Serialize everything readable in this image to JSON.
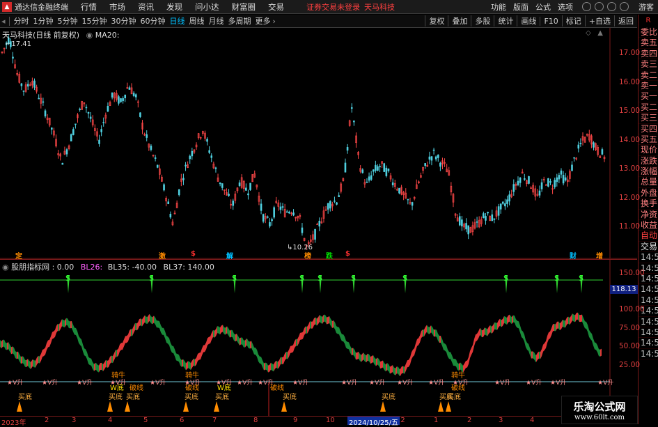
{
  "app": {
    "name": "通达信金融终端",
    "menus": [
      "行情",
      "市场",
      "资讯",
      "发现",
      "问小达",
      "财富圈",
      "交易"
    ],
    "notice": "证券交易未登录",
    "stock_name": "天马科技",
    "right_menus": [
      "功能",
      "版面",
      "公式",
      "选项"
    ],
    "guest": "游客"
  },
  "toolbar": {
    "periods": [
      "分时",
      "1分钟",
      "5分钟",
      "15分钟",
      "30分钟",
      "60分钟",
      "日线",
      "周线",
      "月线",
      "多周期",
      "更多"
    ],
    "active_period": "日线",
    "buttons": [
      "复权",
      "叠加",
      "多股",
      "统计",
      "画线",
      "F10",
      "标记",
      "+自选",
      "返回"
    ]
  },
  "right_panel": {
    "top": "R",
    "items": [
      "委比",
      "卖五",
      "卖四",
      "卖三",
      "卖二",
      "卖一",
      "买一",
      "买二",
      "买三",
      "买四",
      "买五",
      "现价",
      "涨跌",
      "涨幅",
      "总量",
      "外盘",
      "换手",
      "净资",
      "收益",
      "自动",
      "交易",
      "14:56",
      "14:56",
      "14:56",
      "14:56",
      "14:56",
      "14:56",
      "14:56",
      "14:56",
      "14:56",
      "14:56"
    ]
  },
  "main_chart": {
    "title": "天马科技(日线 前复权)",
    "indicator": "MA20:",
    "high_label": "17.41",
    "low_label": "10.26",
    "y_ticks": [
      "17.00",
      "16.00",
      "15.00",
      "14.00",
      "13.00",
      "12.00",
      "11.00"
    ],
    "events": [
      {
        "t": "定",
        "c": "#ff8c00"
      },
      {
        "t": "激",
        "c": "#ff8c00"
      },
      {
        "t": "$",
        "c": "#ff3030"
      },
      {
        "t": "解",
        "c": "#00c0ff"
      },
      {
        "t": "榜",
        "c": "#ff8c00"
      },
      {
        "t": "跌",
        "c": "#00e000"
      },
      {
        "t": "$",
        "c": "#ff3030"
      },
      {
        "t": "财",
        "c": "#00c0ff"
      },
      {
        "t": "增",
        "c": "#ff8c00"
      }
    ]
  },
  "sub_chart": {
    "title": "股朋指标网",
    "v0": ": 0.00",
    "bl26": "BL26:",
    "bl35": "BL35: -40.00",
    "bl37": "BL37: 140.00",
    "y_ticks": [
      "150.00",
      "100.00",
      "75.00",
      "50.00",
      "25.00"
    ],
    "current_value": "118.13",
    "signal_s": "S",
    "signal_up": "V升",
    "labels": [
      "骑牛",
      "W底",
      "破线",
      "买底",
      "骑牛",
      "破线"
    ]
  },
  "x_axis": {
    "labels": [
      "2023年",
      "2",
      "3",
      "4",
      "5",
      "6",
      "7",
      "8",
      "9",
      "10",
      "11",
      "12",
      "1",
      "2",
      "3",
      "4"
    ],
    "selected_date": "2024/10/25/五"
  },
  "watermark": {
    "title": "乐淘公式网",
    "url": "www.60lt.com"
  },
  "chart_data": {
    "type": "candlestick",
    "title": "天马科技(日线 前复权)",
    "ylim": [
      10.2,
      17.5
    ],
    "close_path": [
      16.9,
      17.41,
      16.2,
      15.6,
      16.0,
      15.4,
      14.8,
      14.1,
      13.2,
      13.8,
      14.6,
      15.3,
      14.6,
      13.9,
      14.9,
      15.5,
      15.2,
      15.8,
      15.4,
      14.3,
      13.6,
      13.0,
      12.1,
      11.1,
      12.5,
      13.2,
      13.8,
      14.3,
      13.5,
      12.7,
      12.2,
      11.7,
      12.6,
      12.2,
      12.8,
      11.4,
      11.1,
      11.8,
      11.5,
      11.6,
      11.3,
      10.26,
      10.7,
      11.3,
      11.8,
      11.9,
      12.6,
      15.1,
      13.2,
      12.4,
      12.9,
      13.1,
      12.8,
      12.4,
      12.1,
      11.7,
      12.5,
      13.1,
      13.5,
      13.2,
      12.9,
      11.5,
      11.0,
      10.9,
      11.1,
      11.4,
      11.3,
      11.6,
      11.9,
      12.4,
      12.8,
      12.5,
      12.0,
      12.6,
      12.4,
      12.8,
      12.5,
      13.3,
      13.9,
      14.1,
      13.6,
      13.4
    ],
    "candle_count": 280,
    "x_range": [
      "2023-01",
      "2024-04"
    ]
  }
}
